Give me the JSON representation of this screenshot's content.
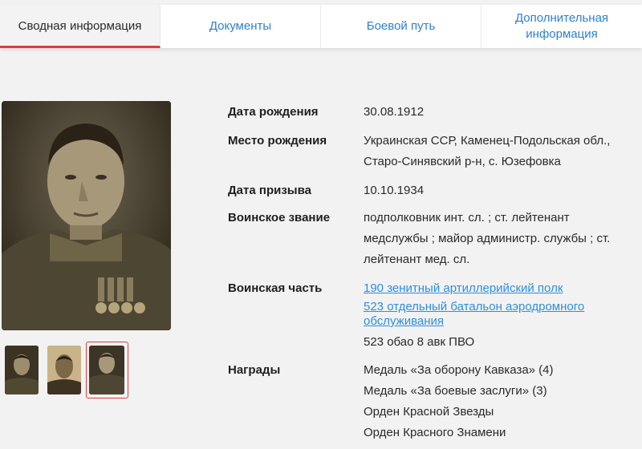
{
  "tabs": [
    "Сводная информация",
    "Документы",
    "Боевой путь",
    "Дополнительная информация"
  ],
  "info": {
    "birth_date_label": "Дата рождения",
    "birth_date": "30.08.1912",
    "birth_place_label": "Место рождения",
    "birth_place_line1": "Украинская ССР, Каменец-Подольская обл.,",
    "birth_place_line2": "Старо-Синявский р-н, с. Юзефовка",
    "draft_date_label": "Дата призыва",
    "draft_date": "10.10.1934",
    "rank_label": "Воинское звание",
    "rank_line1": "подполковник инт. сл. ; ст. лейтенант",
    "rank_line2": "медслужбы ; майор администр. службы ; ст.",
    "rank_line3": "лейтенант мед. сл.",
    "unit_label": "Воинская часть",
    "unit_link1": "190 зенитный артиллерийский полк",
    "unit_link2_line1": "523 отдельный батальон аэродромного",
    "unit_link2_line2": "обслуживания",
    "unit_text": "523 обао 8 авк ПВО",
    "awards_label": "Награды",
    "awards": [
      "Медаль «За оборону Кавказа» (4)",
      "Медаль «За боевые заслуги» (3)",
      "Орден Красной Звезды",
      "Орден Красного Знамени"
    ]
  },
  "photos": {
    "count": 3,
    "selected_index": 3
  },
  "colors": {
    "link": "#2e8fe0",
    "accent": "#e03a3a",
    "background": "#f2f2f2"
  }
}
